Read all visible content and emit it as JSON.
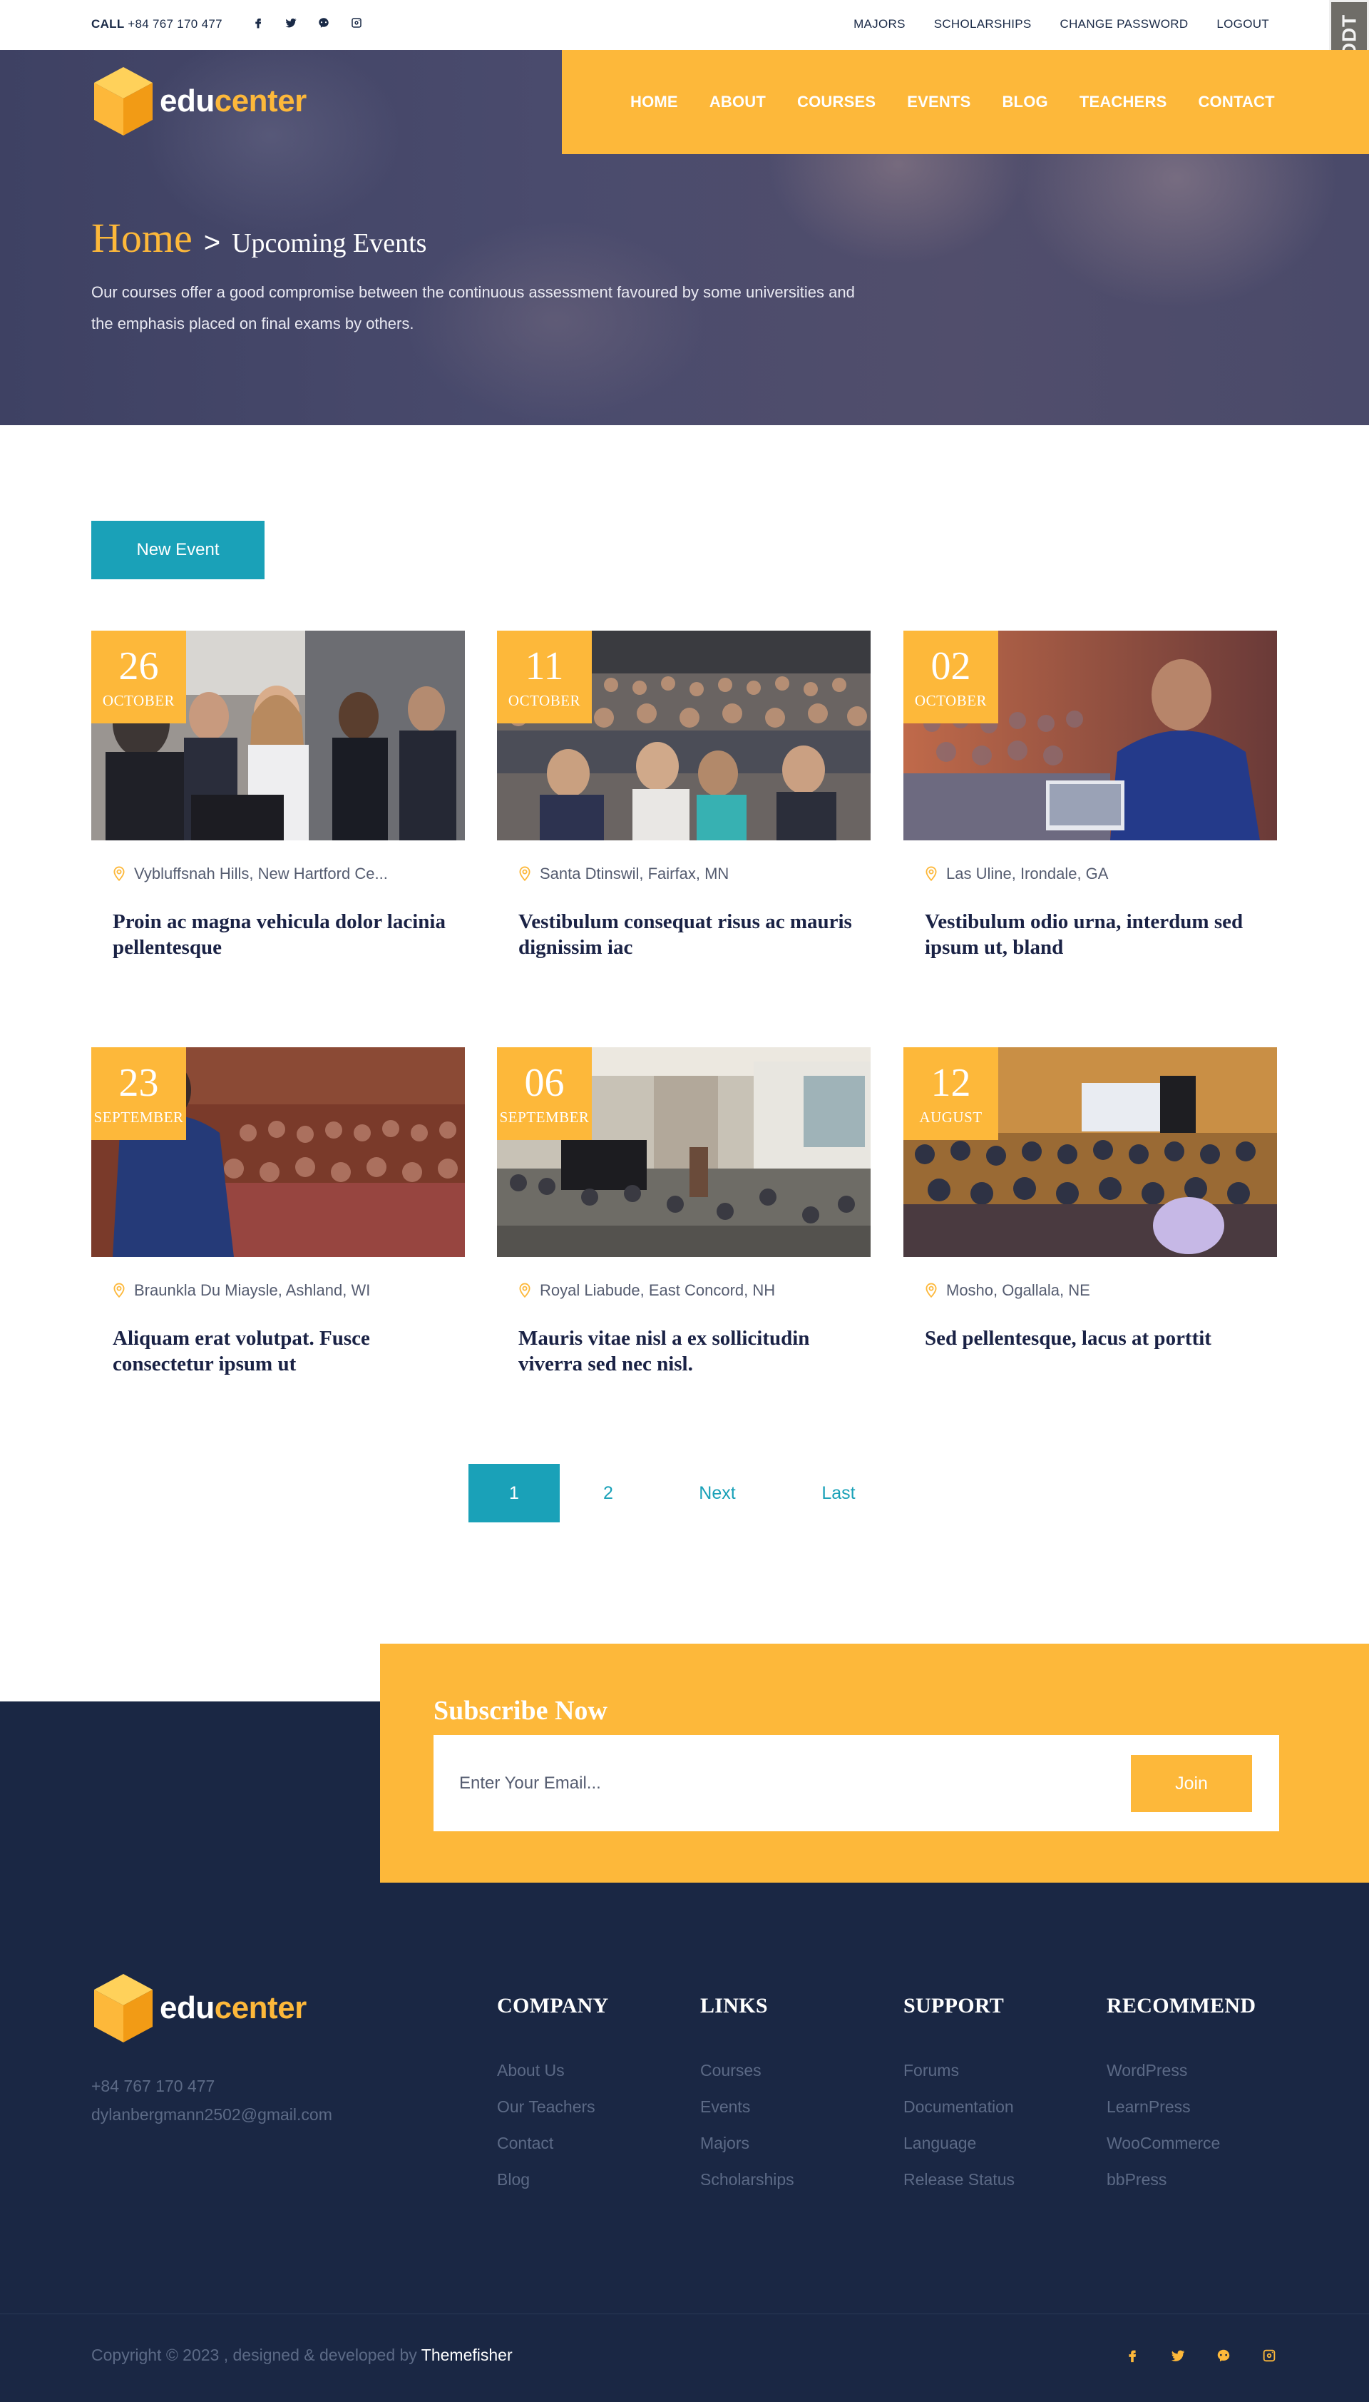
{
  "topbar": {
    "call_label": "CALL",
    "phone": "+84 767 170 477",
    "social_icons": [
      "facebook-icon",
      "twitter-icon",
      "github-icon",
      "instagram-icon"
    ],
    "links": [
      "MAJORS",
      "SCHOLARSHIPS",
      "CHANGE PASSWORD",
      "LOGOUT"
    ],
    "badge": "DDT"
  },
  "brand": {
    "edu": "edu",
    "center": "center",
    "accent_color": "#fdb83a",
    "teal_color": "#1aa1b8",
    "navy_color": "#1a2744"
  },
  "nav": [
    "HOME",
    "ABOUT",
    "COURSES",
    "EVENTS",
    "BLOG",
    "TEACHERS",
    "CONTACT"
  ],
  "hero": {
    "breadcrumb_home": "Home",
    "breadcrumb_sep": ">",
    "breadcrumb_current": "Upcoming Events",
    "description": "Our courses offer a good compromise between the continuous assessment favoured by some universities and the emphasis placed on final exams by others."
  },
  "new_event_label": "New Event",
  "events": [
    {
      "day": "26",
      "month": "OCTOBER",
      "location": "Vybluffsnah Hills, New Hartford Ce...",
      "title": "Proin ac magna vehicula dolor lacinia pellentesque"
    },
    {
      "day": "11",
      "month": "OCTOBER",
      "location": "Santa Dtinswil, Fairfax, MN",
      "title": "Vestibulum consequat risus ac mauris dignissim iac"
    },
    {
      "day": "02",
      "month": "OCTOBER",
      "location": "Las Uline, Irondale, GA",
      "title": "Vestibulum odio urna, interdum sed ipsum ut, bland"
    },
    {
      "day": "23",
      "month": "SEPTEMBER",
      "location": "Braunkla Du Miaysle, Ashland, WI",
      "title": "Aliquam erat volutpat. Fusce consectetur ipsum ut"
    },
    {
      "day": "06",
      "month": "SEPTEMBER",
      "location": "Royal Liabude, East Concord, NH",
      "title": "Mauris vitae nisl a ex sollicitudin viverra sed nec nisl."
    },
    {
      "day": "12",
      "month": "AUGUST",
      "location": "Mosho, Ogallala, NE",
      "title": "Sed pellentesque, lacus at porttit"
    }
  ],
  "pagination": {
    "current": "1",
    "page2": "2",
    "next": "Next",
    "last": "Last"
  },
  "subscribe": {
    "heading": "Subscribe Now",
    "placeholder": "Enter Your Email...",
    "button": "Join"
  },
  "footer": {
    "phone": "+84 767 170 477",
    "email": "dylanbergmann2502@gmail.com",
    "columns": [
      {
        "heading": "COMPANY",
        "items": [
          "About Us",
          "Our Teachers",
          "Contact",
          "Blog"
        ]
      },
      {
        "heading": "LINKS",
        "items": [
          "Courses",
          "Events",
          "Majors",
          "Scholarships"
        ]
      },
      {
        "heading": "SUPPORT",
        "items": [
          "Forums",
          "Documentation",
          "Language",
          "Release Status"
        ]
      },
      {
        "heading": "RECOMMEND",
        "items": [
          "WordPress",
          "LearnPress",
          "WooCommerce",
          "bbPress"
        ]
      }
    ],
    "copyright": "Copyright © 2023 , designed & developed by",
    "copyright_brand": "Themefisher"
  }
}
